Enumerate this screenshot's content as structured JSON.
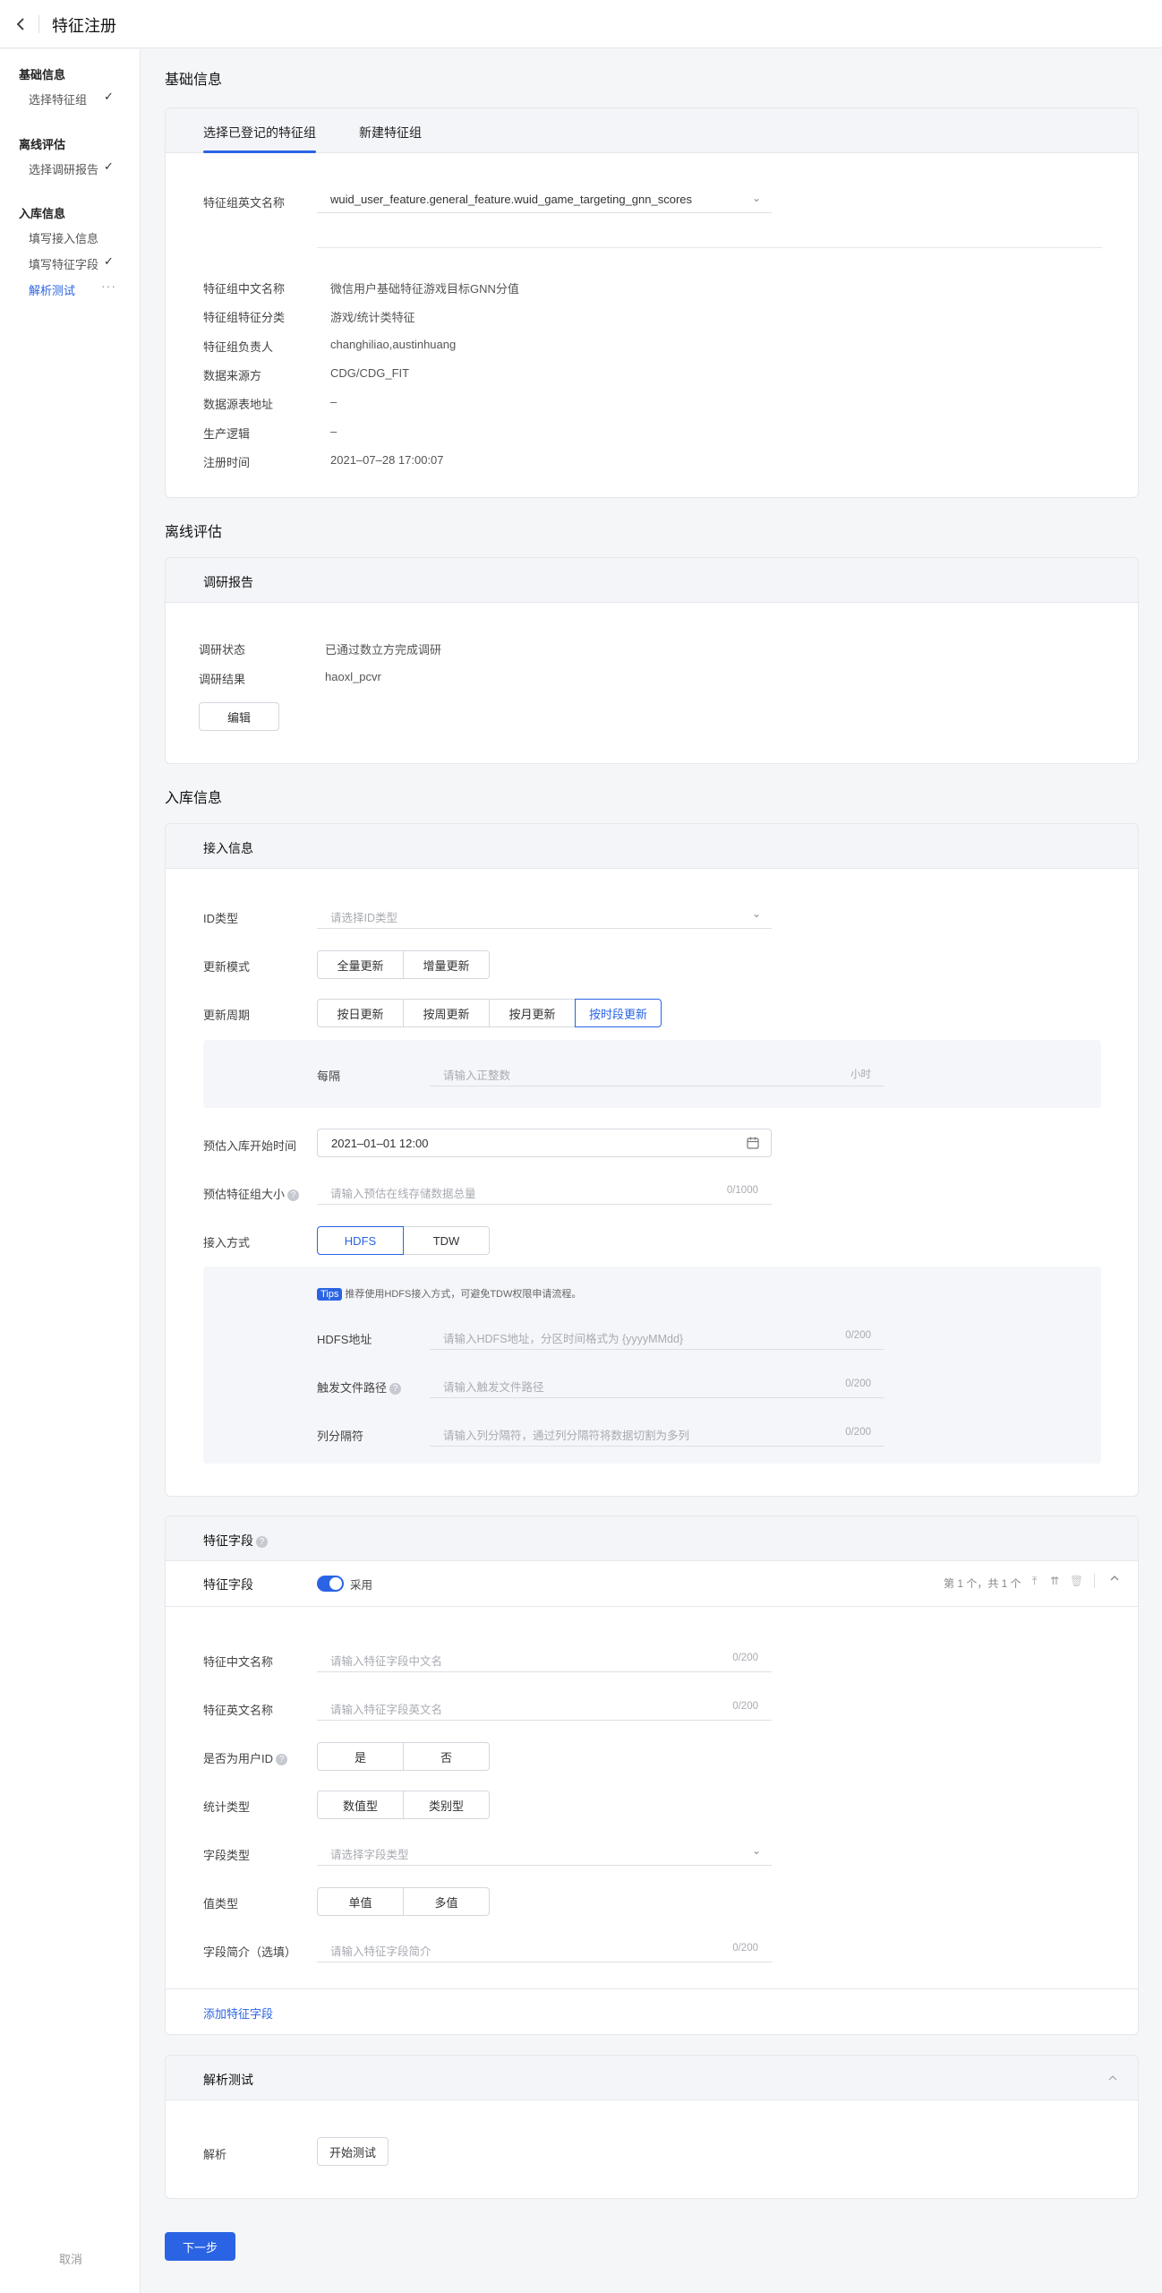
{
  "header": {
    "title": "特征注册"
  },
  "sidebar": {
    "groups": [
      {
        "label": "基础信息",
        "items": [
          {
            "label": "选择特征组",
            "status": "done"
          }
        ]
      },
      {
        "label": "离线评估",
        "items": [
          {
            "label": "选择调研报告",
            "status": "done"
          }
        ]
      },
      {
        "label": "入库信息",
        "items": [
          {
            "label": "填写接入信息",
            "status": ""
          },
          {
            "label": "填写特征字段",
            "status": "done"
          },
          {
            "label": "解析测试",
            "status": "active"
          }
        ]
      }
    ],
    "cancel_label": "取消"
  },
  "basic": {
    "section_title": "基础信息",
    "tabs": [
      "选择已登记的特征组",
      "新建特征组"
    ],
    "en_name_label": "特征组英文名称",
    "en_name_value": "wuid_user_feature.general_feature.wuid_game_targeting_gnn_scores",
    "rows": [
      {
        "label": "特征组中文名称",
        "value": "微信用户基础特征游戏目标GNN分值"
      },
      {
        "label": "特征组特征分类",
        "value": "游戏/统计类特征"
      },
      {
        "label": "特征组负责人",
        "value": "changhiliao,austinhuang"
      },
      {
        "label": "数据来源方",
        "value": "CDG/CDG_FIT"
      },
      {
        "label": "数据源表地址",
        "value": "–"
      },
      {
        "label": "生产逻辑",
        "value": "–"
      },
      {
        "label": "注册时间",
        "value": "2021–07–28 17:00:07"
      }
    ]
  },
  "offline": {
    "section_title": "离线评估",
    "card_title": "调研报告",
    "rows": [
      {
        "label": "调研状态",
        "value": "已通过数立方完成调研"
      },
      {
        "label": "调研结果",
        "value": "haoxl_pcvr"
      }
    ],
    "edit_label": "编辑"
  },
  "storage": {
    "section_title": "入库信息",
    "card_title": "接入信息",
    "id_type": {
      "label": "ID类型",
      "placeholder": "请选择ID类型"
    },
    "update_mode": {
      "label": "更新模式",
      "options": [
        "全量更新",
        "增量更新"
      ]
    },
    "update_cycle": {
      "label": "更新周期",
      "options": [
        "按日更新",
        "按周更新",
        "按月更新",
        "按时段更新"
      ],
      "selected": "按时段更新"
    },
    "interval": {
      "label": "每隔",
      "placeholder": "请输入正整数",
      "unit": "小时"
    },
    "start_time": {
      "label": "预估入库开始时间",
      "value": "2021–01–01 12:00"
    },
    "size": {
      "label": "预估特征组大小",
      "placeholder": "请输入预估在线存储数据总量",
      "count": "0/1000"
    },
    "access": {
      "label": "接入方式",
      "options": [
        "HDFS",
        "TDW"
      ],
      "selected": "HDFS"
    },
    "tips_badge": "Tips",
    "tips_text": "推荐使用HDFS接入方式，可避免TDW权限申请流程。",
    "hdfs": {
      "label": "HDFS地址",
      "placeholder": "请输入HDFS地址，分区时间格式为 {yyyyMMdd}",
      "count": "0/200"
    },
    "trigger": {
      "label": "触发文件路径",
      "placeholder": "请输入触发文件路径",
      "count": "0/200"
    },
    "separator": {
      "label": "列分隔符",
      "placeholder": "请输入列分隔符，通过列分隔符将数据切割为多列",
      "count": "0/200"
    }
  },
  "fields": {
    "card_title": "特征字段",
    "row_label": "特征字段",
    "toggle_label": "采用",
    "pager": "第 1 个，共 1 个",
    "cn_name": {
      "label": "特征中文名称",
      "placeholder": "请输入特征字段中文名",
      "count": "0/200"
    },
    "en_name": {
      "label": "特征英文名称",
      "placeholder": "请输入特征字段英文名",
      "count": "0/200"
    },
    "is_user_id": {
      "label": "是否为用户ID",
      "options": [
        "是",
        "否"
      ]
    },
    "stat_type": {
      "label": "统计类型",
      "options": [
        "数值型",
        "类别型"
      ]
    },
    "field_type": {
      "label": "字段类型",
      "placeholder": "请选择字段类型"
    },
    "value_type": {
      "label": "值类型",
      "options": [
        "单值",
        "多值"
      ]
    },
    "desc": {
      "label": "字段简介（选填）",
      "placeholder": "请输入特征字段简介",
      "count": "0/200"
    },
    "add_label": "添加特征字段"
  },
  "parse": {
    "card_title": "解析测试",
    "label": "解析",
    "button": "开始测试"
  },
  "next_label": "下一步",
  "colors": {
    "accent": "#2a64e4"
  }
}
